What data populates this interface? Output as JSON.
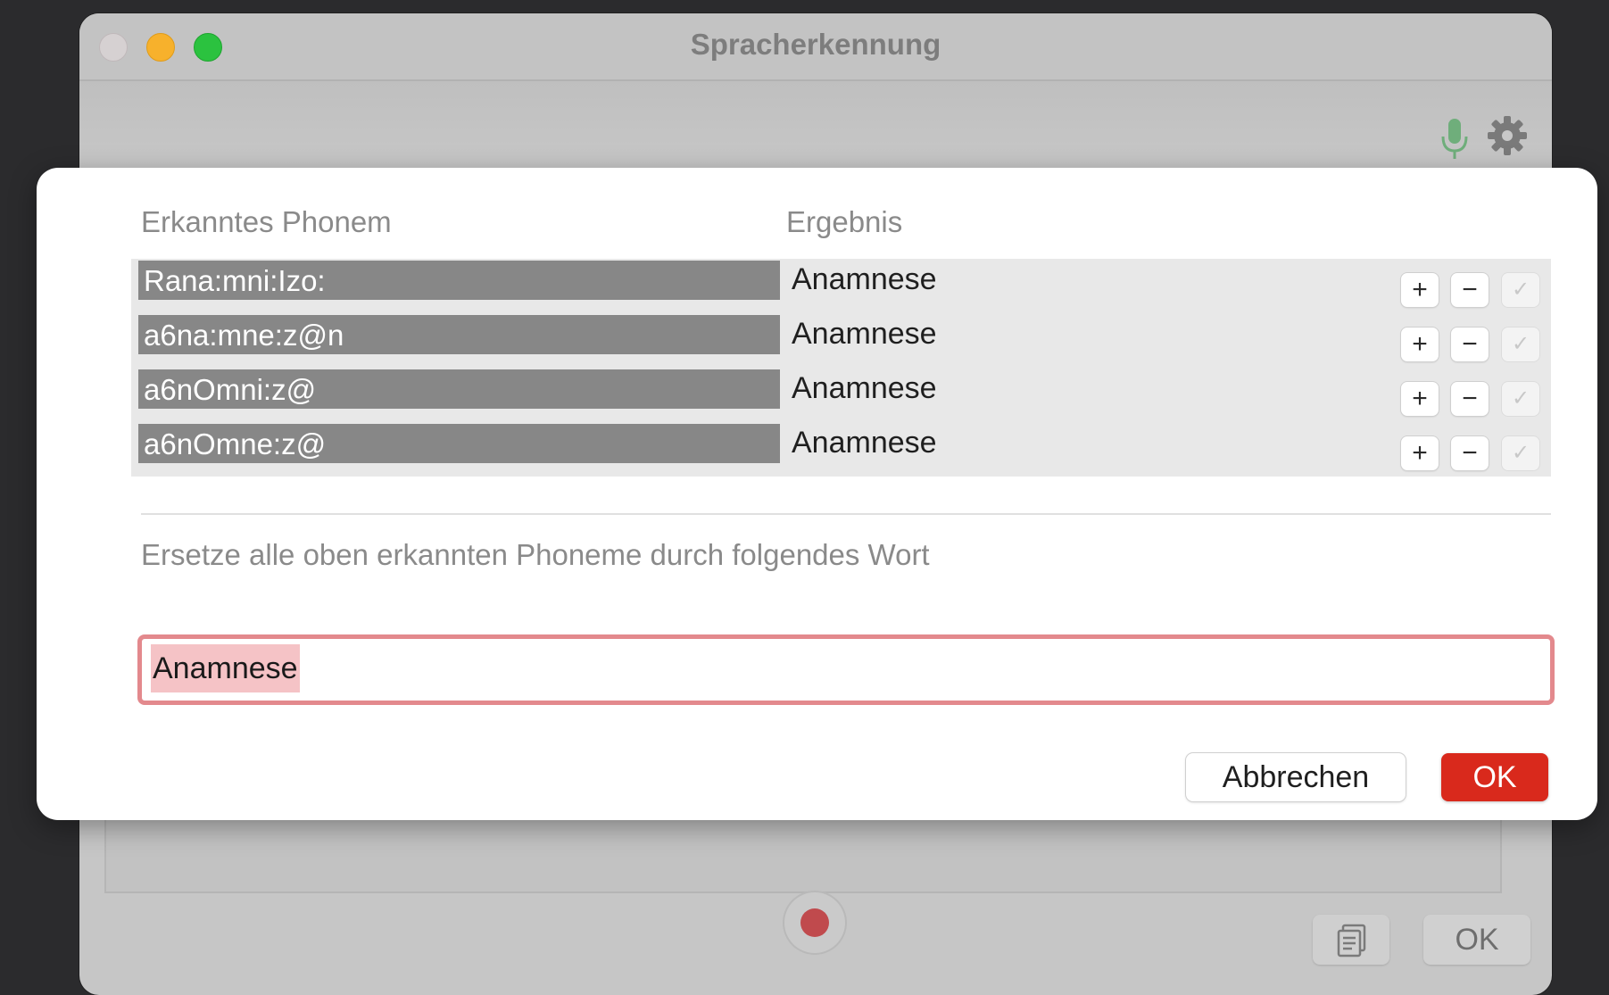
{
  "window": {
    "title": "Spracherkennung"
  },
  "toolbar": {
    "mic_icon": "microphone-icon",
    "settings_icon": "gear-icon",
    "mic_color": "#6fae7b"
  },
  "sheet": {
    "column_headers": {
      "phonem": "Erkanntes Phonem",
      "ergebnis": "Ergebnis"
    },
    "rows": [
      {
        "phonem": "Rana:mni:Izo:",
        "ergebnis": "Anamnese",
        "plus": "+",
        "minus": "−",
        "check": "✓"
      },
      {
        "phonem": "a6na:mne:z@n",
        "ergebnis": "Anamnese",
        "plus": "+",
        "minus": "−",
        "check": "✓"
      },
      {
        "phonem": "a6nOmni:z@",
        "ergebnis": "Anamnese",
        "plus": "+",
        "minus": "−",
        "check": "✓"
      },
      {
        "phonem": "a6nOmne:z@",
        "ergebnis": "Anamnese",
        "plus": "+",
        "minus": "−",
        "check": "✓"
      }
    ],
    "replace_label": "Ersetze alle oben erkannten Phoneme durch folgendes Wort",
    "replace_value": "Anamnese",
    "cancel_label": "Abbrechen",
    "ok_label": "OK",
    "accent_color": "#d9291c",
    "error_border_color": "#e3898d"
  },
  "bottom_bar": {
    "ok_label": "OK",
    "record_icon": "record-icon",
    "clipboard_icon": "clipboard-icon"
  }
}
